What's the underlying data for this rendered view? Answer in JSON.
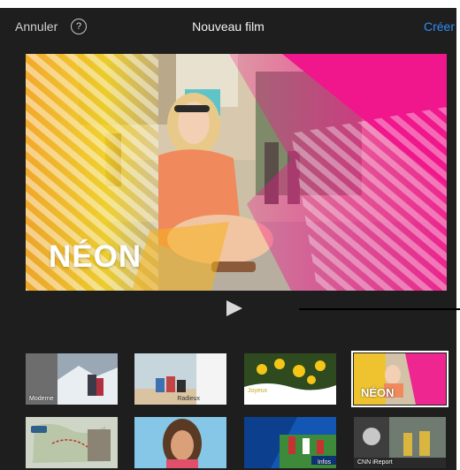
{
  "navbar": {
    "cancel_label": "Annuler",
    "help_glyph": "?",
    "title": "Nouveau film",
    "create_label": "Créer"
  },
  "preview": {
    "theme_label": "NÉON"
  },
  "themes": {
    "selected_index": 3,
    "items": [
      {
        "label": "Moderne"
      },
      {
        "label": "Radieux"
      },
      {
        "label": "Joyeux"
      },
      {
        "label": "NÉON"
      },
      {
        "label": ""
      },
      {
        "label": ""
      },
      {
        "label": "Infos"
      },
      {
        "label": "CNN iReport"
      }
    ]
  },
  "icons": {
    "help": "help-circle-icon",
    "play": "play-icon"
  },
  "colors": {
    "background": "#1e1e1e",
    "accent": "#2f8ff6",
    "neon_pink": "#f0168c",
    "neon_yellow": "#f5d21a"
  }
}
